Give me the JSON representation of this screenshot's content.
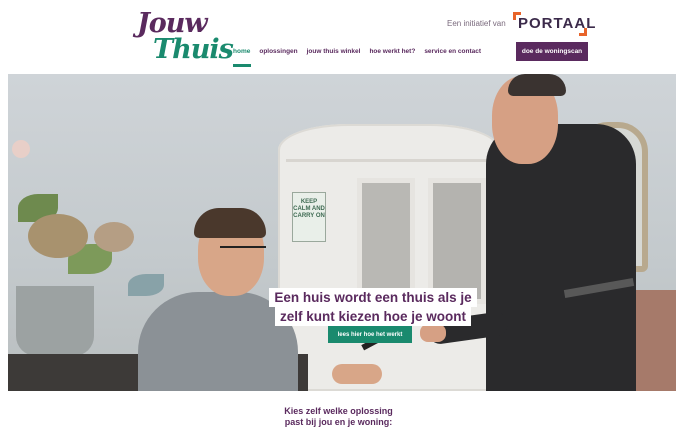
{
  "header": {
    "logo": {
      "line1": "Jouw",
      "line2": "Thuis"
    },
    "initiative_text": "Een initiatief van",
    "partner_logo": "PORTAAL",
    "nav": [
      {
        "label": "home",
        "active": true
      },
      {
        "label": "oplossingen",
        "active": false
      },
      {
        "label": "jouw thuis winkel",
        "active": false
      },
      {
        "label": "hoe werkt het?",
        "active": false
      },
      {
        "label": "service en contact",
        "active": false
      }
    ],
    "cta_label": "doe de woningscan"
  },
  "hero": {
    "sign_text": "KEEP CALM AND CARRY ON",
    "headline_line1": "Een huis wordt een thuis als je",
    "headline_line2": "zelf kunt kiezen hoe je woont",
    "button_label": "lees hier hoe het werkt"
  },
  "intro": {
    "line1": "Kies zelf welke oplossing",
    "line2": "past bij jou en je woning:"
  },
  "colors": {
    "brand_purple": "#5a2a5e",
    "brand_green": "#1a8a6e",
    "portaal_orange": "#e8642a"
  }
}
